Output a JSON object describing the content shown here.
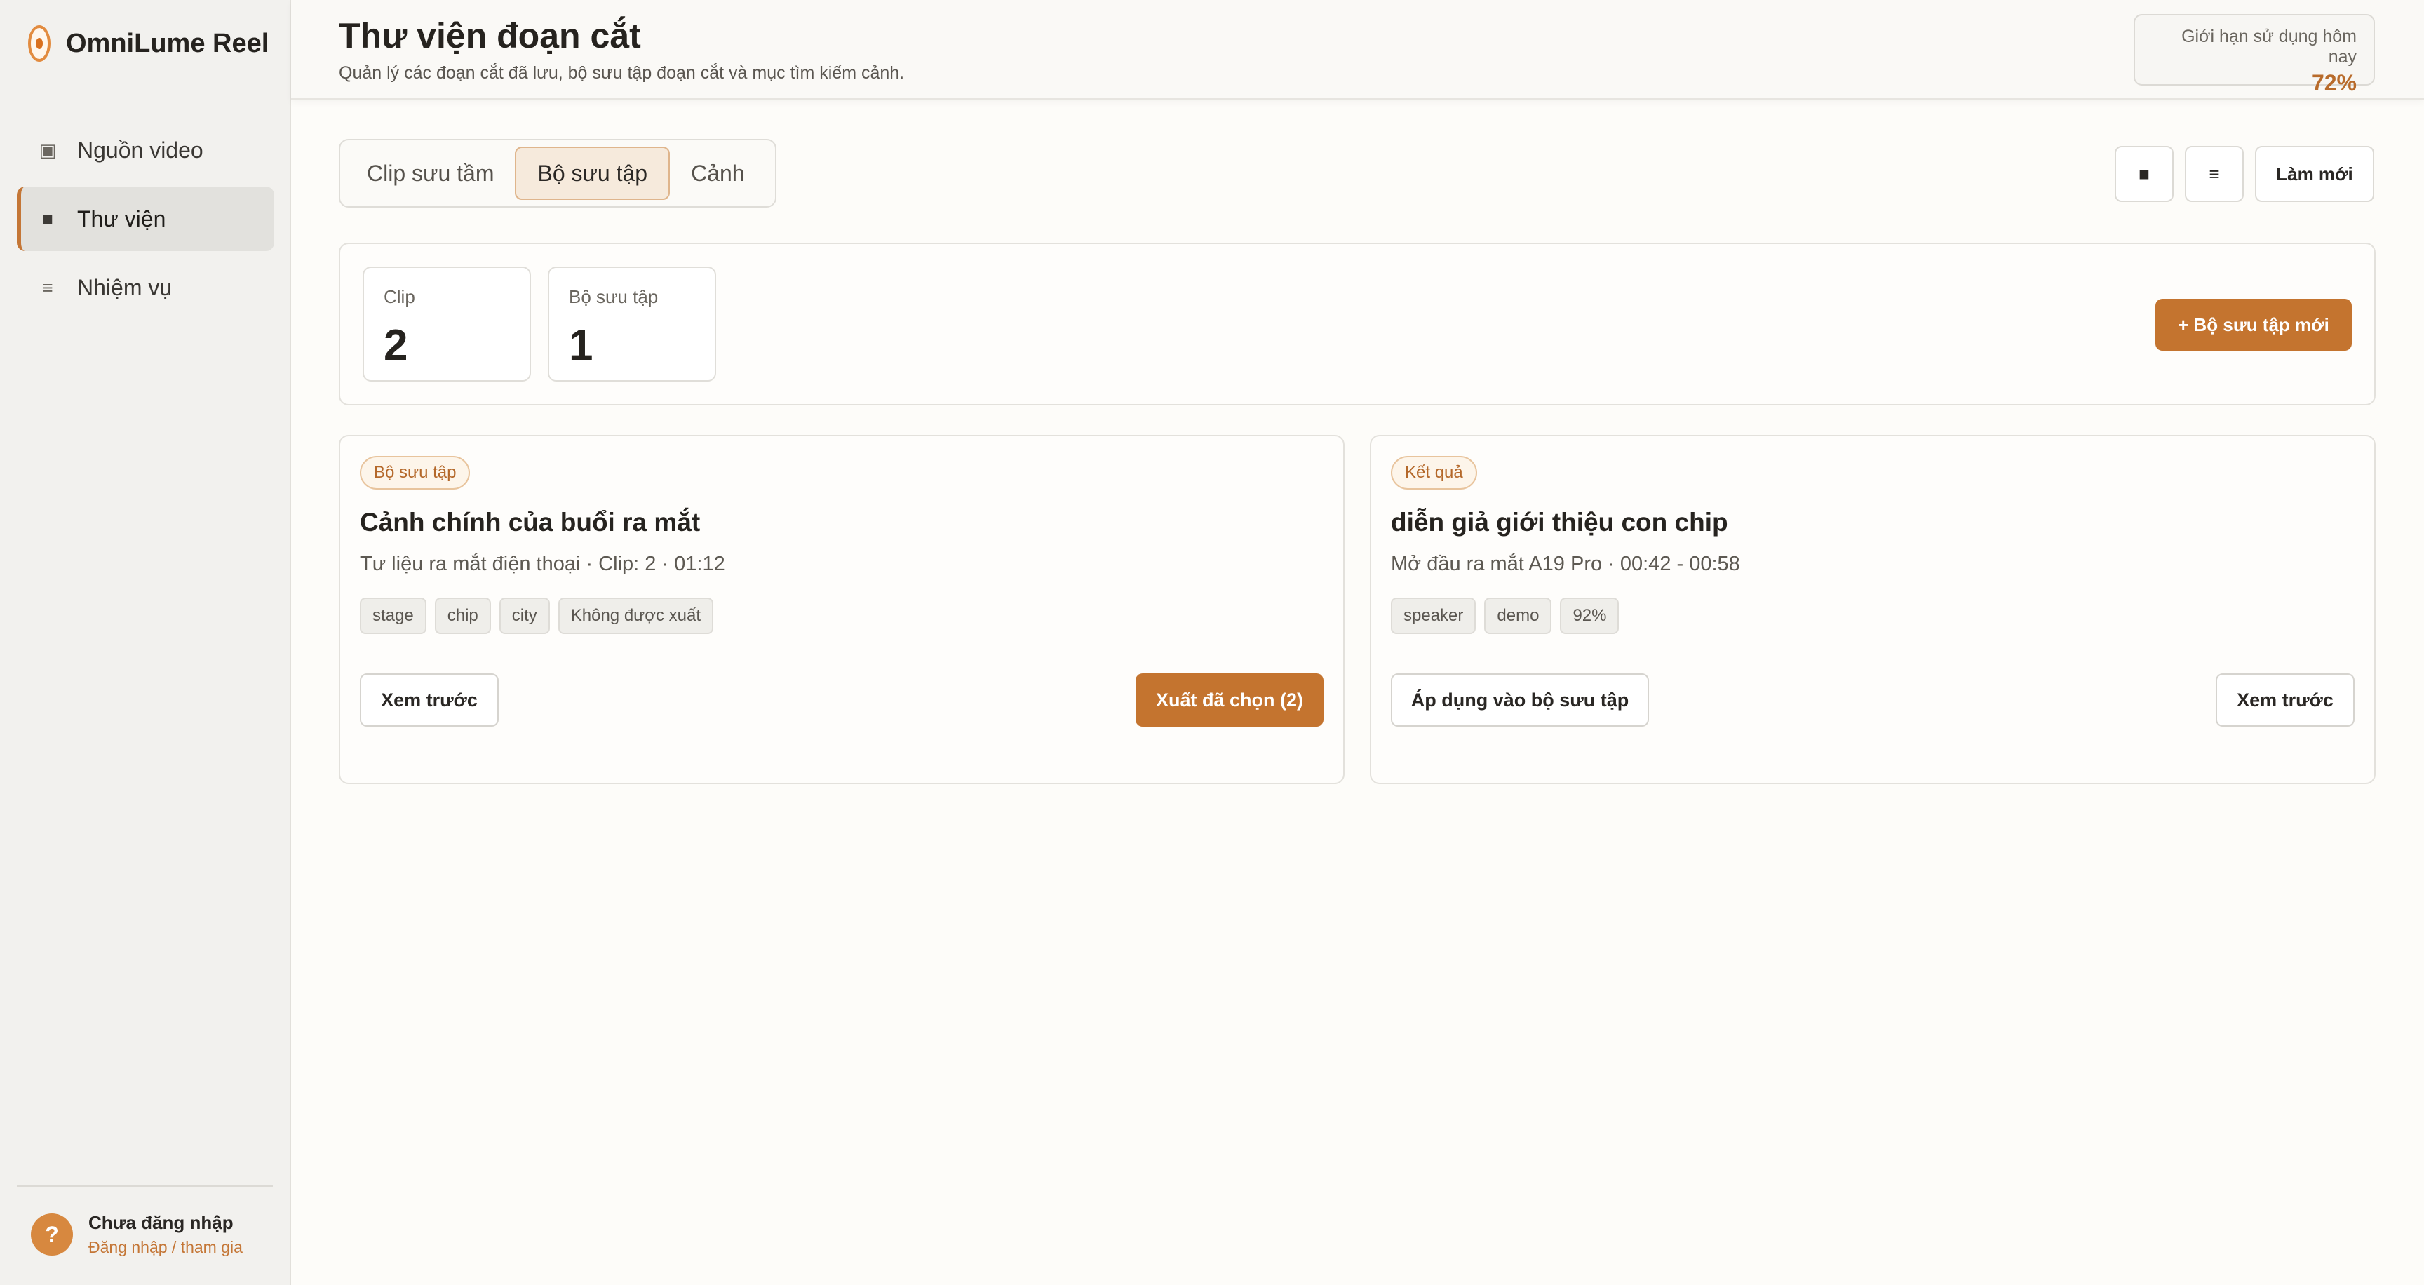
{
  "app": {
    "name": "OmniLume Reel"
  },
  "sidebar": {
    "items": [
      {
        "label": "Nguồn video",
        "icon": "video-source-icon",
        "glyph": "▣",
        "active": false
      },
      {
        "label": "Thư viện",
        "icon": "library-icon",
        "glyph": "■",
        "active": true
      },
      {
        "label": "Nhiệm vụ",
        "icon": "tasks-icon",
        "glyph": "≡",
        "active": false
      }
    ],
    "user": {
      "avatar": "?",
      "name": "Chưa đăng nhập",
      "link": "Đăng nhập / tham gia"
    }
  },
  "header": {
    "title": "Thư viện đoạn cắt",
    "subtitle": "Quản lý các đoạn cắt đã lưu, bộ sưu tập đoạn cắt và mục tìm kiếm cảnh.",
    "usage_label": "Giới hạn sử dụng hôm nay",
    "usage_value": "72%"
  },
  "tabs": [
    {
      "label": "Clip sưu tầm",
      "active": false
    },
    {
      "label": "Bộ sưu tập",
      "active": true
    },
    {
      "label": "Cảnh",
      "active": false
    }
  ],
  "toolbar": {
    "grid_glyph": "■",
    "list_glyph": "≡",
    "refresh_label": "Làm mới"
  },
  "stats": {
    "clip_label": "Clip",
    "clip_value": "2",
    "collection_label": "Bộ sưu tập",
    "collection_value": "1",
    "new_collection_label": "+ Bộ sưu tập mới"
  },
  "cards": [
    {
      "badge": "Bộ sưu tập",
      "title": "Cảnh chính của buổi ra mắt",
      "meta": "Tư liệu ra mắt điện thoại · Clip: 2 · 01:12",
      "tags": [
        "stage",
        "chip",
        "city",
        "Không được xuất"
      ],
      "preview_label": "Xem trước",
      "export_label": "Xuất đã chọn (2)"
    },
    {
      "badge": "Kết quả",
      "title": "diễn giả giới thiệu con chip",
      "meta": "Mở đầu ra mắt A19 Pro · 00:42 - 00:58",
      "tags": [
        "speaker",
        "demo",
        "92%"
      ],
      "apply_label": "Áp dụng vào bộ sưu tập",
      "preview_label": "Xem trước"
    }
  ],
  "colors": {
    "accent": "#c4742f",
    "sidebar_bg": "#f2f1ee",
    "page_bg": "#fdfcf9"
  }
}
